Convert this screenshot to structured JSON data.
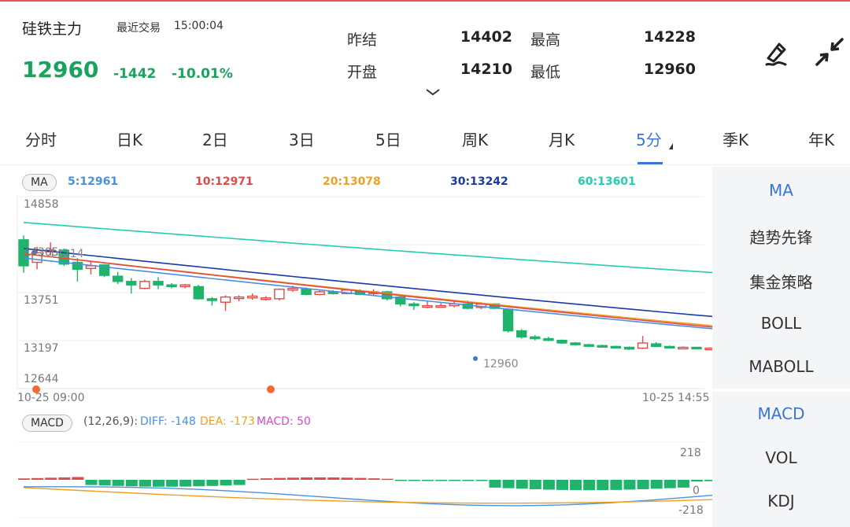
{
  "header": {
    "name": "硅铁主力",
    "trade_label": "最近交易",
    "trade_time": "15:00:04",
    "price": "12960",
    "change": "-1442",
    "change_pct": "-10.01%",
    "quotes": [
      {
        "label": "昨结",
        "value": "14402"
      },
      {
        "label": "最高",
        "value": "14228"
      },
      {
        "label": "开盘",
        "value": "14210"
      },
      {
        "label": "最低",
        "value": "12960"
      }
    ],
    "icons": [
      "pen-sign-icon",
      "shrink-arrows-icon",
      "chevron-down-icon"
    ]
  },
  "tabs": [
    {
      "label": "分时"
    },
    {
      "label": "日K"
    },
    {
      "label": "2日"
    },
    {
      "label": "3日"
    },
    {
      "label": "5日"
    },
    {
      "label": "周K"
    },
    {
      "label": "月K"
    },
    {
      "label": "5分"
    },
    {
      "label": "季K"
    },
    {
      "label": "年K"
    }
  ],
  "active_tab": "5分",
  "indicators": {
    "ma_label": "MA",
    "ma_items": [
      {
        "label": "5:12961",
        "color": "#4a90e2"
      },
      {
        "label": "10:12971",
        "color": "#e04a4a"
      },
      {
        "label": "20:13078",
        "color": "#f0a020"
      },
      {
        "label": "30:13242",
        "color": "#1a3aa8"
      },
      {
        "label": "60:13601",
        "color": "#22cfae"
      }
    ],
    "macd_label": "MACD",
    "macd_params": "(12,26,9):",
    "diff": "DIFF: -148",
    "dea": "DEA: -173",
    "macd": "MACD: 50",
    "diff_color": "#4a90e2",
    "dea_color": "#f0a020",
    "macd_color": "#d04ad0"
  },
  "chart_data": {
    "type": "candlestick",
    "ylim": [
      12644,
      14858
    ],
    "y_ticks": [
      "14858",
      "14305",
      "13751",
      "13197",
      "12644"
    ],
    "x_start": "10-25 09:00",
    "x_end": "10-25 14:55",
    "high_mark": "14214",
    "low_mark": "12960",
    "up_color": "#e04a4a",
    "down_color": "#1fb36b",
    "candles": [
      [
        14360,
        14060,
        14410,
        13980
      ],
      [
        14100,
        14210,
        14280,
        14020
      ],
      [
        14230,
        14240,
        14330,
        14180
      ],
      [
        14240,
        14080,
        14260,
        14060
      ],
      [
        14100,
        14020,
        14150,
        13880
      ],
      [
        14030,
        14060,
        14120,
        13960
      ],
      [
        14070,
        13950,
        14080,
        13930
      ],
      [
        13940,
        13880,
        13990,
        13850
      ],
      [
        13880,
        13840,
        13920,
        13740
      ],
      [
        13800,
        13880,
        13900,
        13790
      ],
      [
        13880,
        13840,
        13930,
        13790
      ],
      [
        13840,
        13820,
        13860,
        13800
      ],
      [
        13820,
        13840,
        13850,
        13800
      ],
      [
        13820,
        13680,
        13840,
        13670
      ],
      [
        13680,
        13660,
        13700,
        13600
      ],
      [
        13640,
        13700,
        13720,
        13540
      ],
      [
        13690,
        13700,
        13720,
        13650
      ],
      [
        13690,
        13710,
        13740,
        13670
      ],
      [
        13680,
        13690,
        13710,
        13660
      ],
      [
        13680,
        13790,
        13800,
        13660
      ],
      [
        13780,
        13800,
        13830,
        13760
      ],
      [
        13790,
        13730,
        13810,
        13720
      ],
      [
        13730,
        13760,
        13780,
        13720
      ],
      [
        13760,
        13740,
        13780,
        13730
      ],
      [
        13740,
        13780,
        13800,
        13730
      ],
      [
        13760,
        13730,
        13790,
        13720
      ],
      [
        13740,
        13760,
        13790,
        13720
      ],
      [
        13760,
        13680,
        13770,
        13660
      ],
      [
        13700,
        13620,
        13710,
        13590
      ],
      [
        13620,
        13600,
        13640,
        13550
      ],
      [
        13590,
        13600,
        13650,
        13570
      ],
      [
        13600,
        13600,
        13630,
        13580
      ],
      [
        13600,
        13620,
        13660,
        13580
      ],
      [
        13620,
        13570,
        13660,
        13560
      ],
      [
        13580,
        13620,
        13640,
        13560
      ],
      [
        13620,
        13570,
        13630,
        13560
      ],
      [
        13560,
        13310,
        13570,
        13290
      ],
      [
        13310,
        13240,
        13330,
        13220
      ],
      [
        13240,
        13220,
        13260,
        13200
      ],
      [
        13220,
        13200,
        13240,
        13190
      ],
      [
        13200,
        13170,
        13210,
        13160
      ],
      [
        13170,
        13150,
        13180,
        13140
      ],
      [
        13150,
        13140,
        13160,
        13130
      ],
      [
        13140,
        13130,
        13150,
        13120
      ],
      [
        13130,
        13120,
        13140,
        13110
      ],
      [
        13120,
        13100,
        13130,
        13090
      ],
      [
        13110,
        13170,
        13250,
        13100
      ],
      [
        13160,
        13130,
        13180,
        13120
      ],
      [
        13130,
        13120,
        13140,
        13110
      ],
      [
        13120,
        13120,
        13130,
        13110
      ],
      [
        13120,
        13110,
        13120,
        13100
      ],
      [
        13110,
        13110,
        13120,
        13100
      ],
      [
        13110,
        13100,
        13110,
        13090
      ],
      [
        13100,
        13100,
        13110,
        13090
      ],
      [
        13100,
        13100,
        13110,
        13090
      ],
      [
        13100,
        13100,
        13100,
        13090
      ],
      [
        13100,
        13100,
        13100,
        13090
      ],
      [
        13100,
        13100,
        13100,
        13090
      ],
      [
        13100,
        13100,
        13100,
        13090
      ],
      [
        13100,
        13100,
        13100,
        13090
      ],
      [
        13100,
        13100,
        13100,
        13090
      ],
      [
        13100,
        13100,
        13100,
        13090
      ],
      [
        13100,
        13100,
        13100,
        13090
      ],
      [
        13100,
        13100,
        13100,
        13090
      ],
      [
        13100,
        13100,
        13100,
        13090
      ],
      [
        13100,
        13100,
        13100,
        13090
      ],
      [
        13100,
        13100,
        13100,
        13090
      ],
      [
        13100,
        13100,
        13100,
        13090
      ],
      [
        13100,
        13100,
        13100,
        13090
      ],
      [
        13100,
        13100,
        13100,
        13090
      ],
      [
        13100,
        13100,
        13100,
        13090
      ],
      [
        13100,
        13100,
        13100,
        13090
      ]
    ],
    "ma60": [
      14560,
      13810
    ],
    "ma30": [
      14260,
      13240
    ],
    "ma20": [
      14200,
      13120
    ],
    "ma10": [
      14200,
      13100
    ],
    "ma5": [
      14150,
      13090
    ],
    "macd_ylim": [
      -218,
      218
    ],
    "macd_ticks": [
      "218",
      "0",
      "-218"
    ]
  },
  "side": {
    "main_items": [
      {
        "label": "MA"
      },
      {
        "label": "趋势先锋"
      },
      {
        "label": "集金策略"
      },
      {
        "label": "BOLL"
      },
      {
        "label": "MABOLL"
      }
    ],
    "sub_items": [
      {
        "label": "MACD"
      },
      {
        "label": "VOL"
      },
      {
        "label": "KDJ"
      }
    ]
  }
}
